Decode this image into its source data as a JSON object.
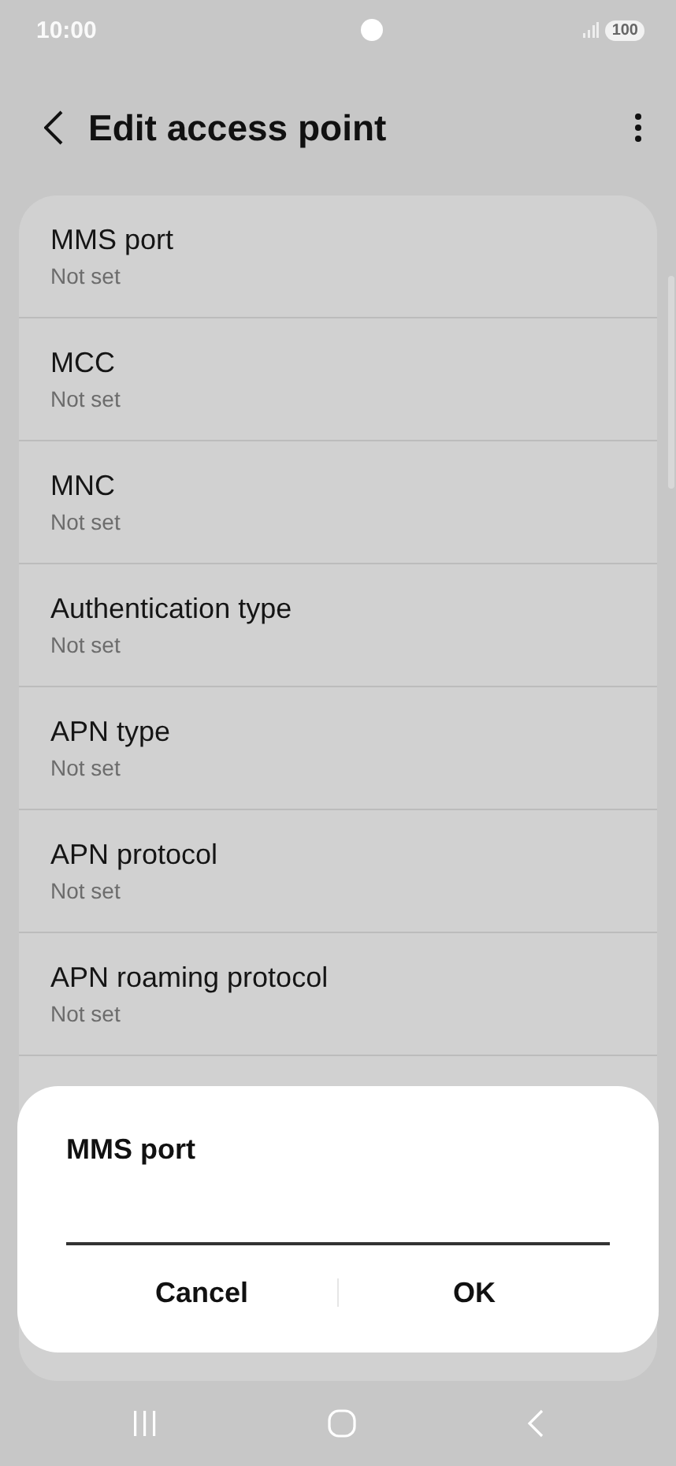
{
  "status_bar": {
    "time": "10:00",
    "battery": "100"
  },
  "header": {
    "title": "Edit access point"
  },
  "settings": [
    {
      "title": "MMS port",
      "value": "Not set"
    },
    {
      "title": "MCC",
      "value": "Not set"
    },
    {
      "title": "MNC",
      "value": "Not set"
    },
    {
      "title": "Authentication type",
      "value": "Not set"
    },
    {
      "title": "APN type",
      "value": "Not set"
    },
    {
      "title": "APN protocol",
      "value": "Not set"
    },
    {
      "title": "APN roaming protocol",
      "value": "Not set"
    }
  ],
  "dialog": {
    "title": "MMS port",
    "buttons": [
      "Cancel",
      "OK"
    ]
  }
}
